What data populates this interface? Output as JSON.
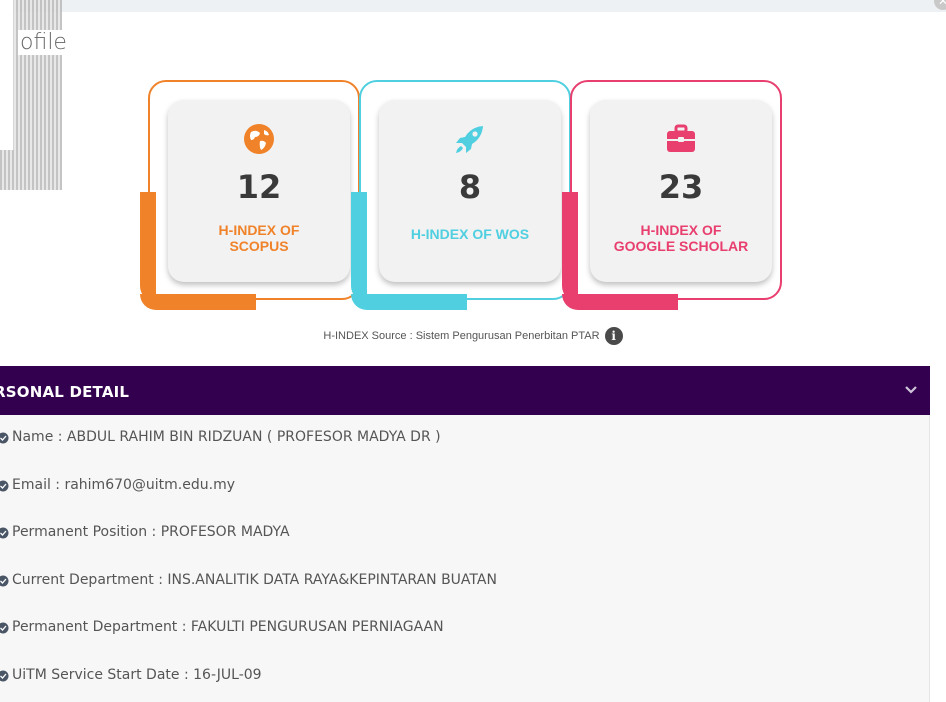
{
  "header": {
    "page_title_fragment": "ofile",
    "close_icon": "close-icon"
  },
  "hindex": {
    "cards": [
      {
        "value": "12",
        "label_line1": "H-INDEX OF",
        "label_line2": "SCOPUS",
        "icon": "globe-icon",
        "color": "#f0832a"
      },
      {
        "value": "8",
        "label_line1": "H-INDEX OF WOS",
        "label_line2": "",
        "icon": "rocket-icon",
        "color": "#4fcfe0"
      },
      {
        "value": "23",
        "label_line1": "H-INDEX OF",
        "label_line2": "GOOGLE SCHOLAR",
        "icon": "briefcase-icon",
        "color": "#e83f6f"
      }
    ],
    "source_text": "H-INDEX Source : Sistem Pengurusan Penerbitan PTAR",
    "info_icon_glyph": "i"
  },
  "personal": {
    "title": "RSONAL DETAIL",
    "header_color": "#33004f",
    "items": [
      "Name : ABDUL RAHIM BIN RIDZUAN ( PROFESOR MADYA DR )",
      "Email : rahim670@uitm.edu.my",
      "Permanent Position : PROFESOR MADYA",
      "Current Department : INS.ANALITIK DATA RAYA&KEPINTARAN BUATAN",
      "Permanent Department : FAKULTI PENGURUSAN PERNIAGAAN",
      "UiTM Service Start Date : 16-JUL-09"
    ]
  }
}
